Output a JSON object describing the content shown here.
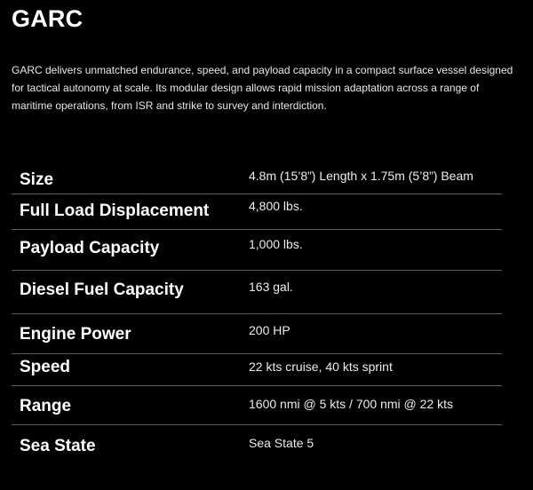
{
  "heading": "GARC",
  "description": "GARC delivers unmatched endurance, speed, and payload capacity in a compact surface vessel designed for tactical autonomy at scale. Its modular design allows rapid mission adaptation across a range of maritime operations, from ISR and strike to survey and interdiction.",
  "specs": [
    {
      "label": "Size",
      "value": "4.8m (15’8”) Length x 1.75m (5’8”) Beam"
    },
    {
      "label": "Full Load Displacement",
      "value": "4,800 lbs."
    },
    {
      "label": "Payload Capacity",
      "value": "1,000 lbs."
    },
    {
      "label": "Diesel Fuel Capacity",
      "value": "163 gal."
    },
    {
      "label": "Engine Power",
      "value": "200 HP"
    },
    {
      "label": "Speed",
      "value": "22 kts cruise, 40 kts sprint"
    },
    {
      "label": "Range",
      "value": "1600 nmi @ 5 kts / 700 nmi @ 22 kts"
    },
    {
      "label": "Sea State",
      "value": "Sea State 5"
    }
  ]
}
